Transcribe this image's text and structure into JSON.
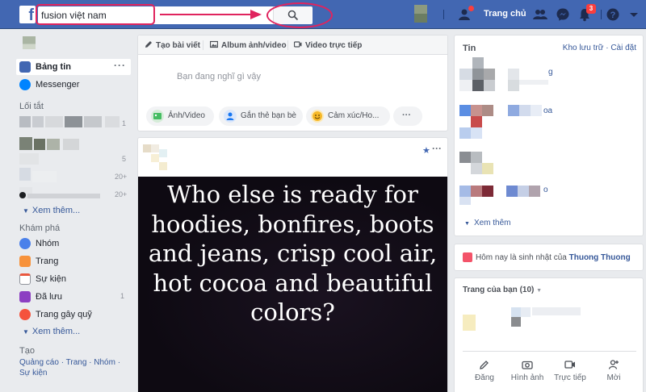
{
  "topbar": {
    "search_value": "fusion việt nam",
    "home_label": "Trang chủ",
    "notifications_count": "3"
  },
  "leftnav": {
    "items": [
      {
        "label": "Bảng tin"
      },
      {
        "label": "Messenger"
      }
    ],
    "shortcuts_header": "Lối tắt",
    "shortcut_counts": [
      "1",
      "5",
      "20+",
      "20+"
    ],
    "see_more_1": "Xem thêm...",
    "explore_header": "Khám phá",
    "explore_items": [
      {
        "label": "Nhóm"
      },
      {
        "label": "Trang"
      },
      {
        "label": "Sự kiện"
      },
      {
        "label": "Đã lưu",
        "count": "1"
      },
      {
        "label": "Trang gây quỹ"
      }
    ],
    "see_more_2": "Xem thêm...",
    "create_header": "Tạo",
    "create_links": "Quảng cáo · Trang · Nhóm · Sự kiện"
  },
  "composer": {
    "tabs": [
      "Tạo bài viết",
      "Album ảnh/video",
      "Video trực tiếp"
    ],
    "placeholder": "Bạn đang nghĩ gì vậy",
    "chips": [
      "Ảnh/Video",
      "Gắn thẻ bạn bè",
      "Cảm xúc/Ho..."
    ]
  },
  "post": {
    "quote": "Who else is ready for hoodies, bonfires, boots and jeans, crisp cool air, hot cocoa and beautiful colors?"
  },
  "stories": {
    "title": "Tin",
    "actions": "Kho lưu trữ · Cài đặt",
    "partial_1": "g",
    "partial_2": "oa",
    "partial_3": "o",
    "see_more": "Xem thêm"
  },
  "birthday": {
    "prefix": "Hôm nay là sinh nhật của",
    "name": "Thuong Thuong"
  },
  "pages": {
    "title": "Trang của bạn (10)",
    "actions": [
      "Đăng",
      "Hình ảnh",
      "Trực tiếp",
      "Mời"
    ]
  },
  "colors": {
    "brand": "#4267b2",
    "annotation": "#e0245e",
    "link": "#365899"
  }
}
